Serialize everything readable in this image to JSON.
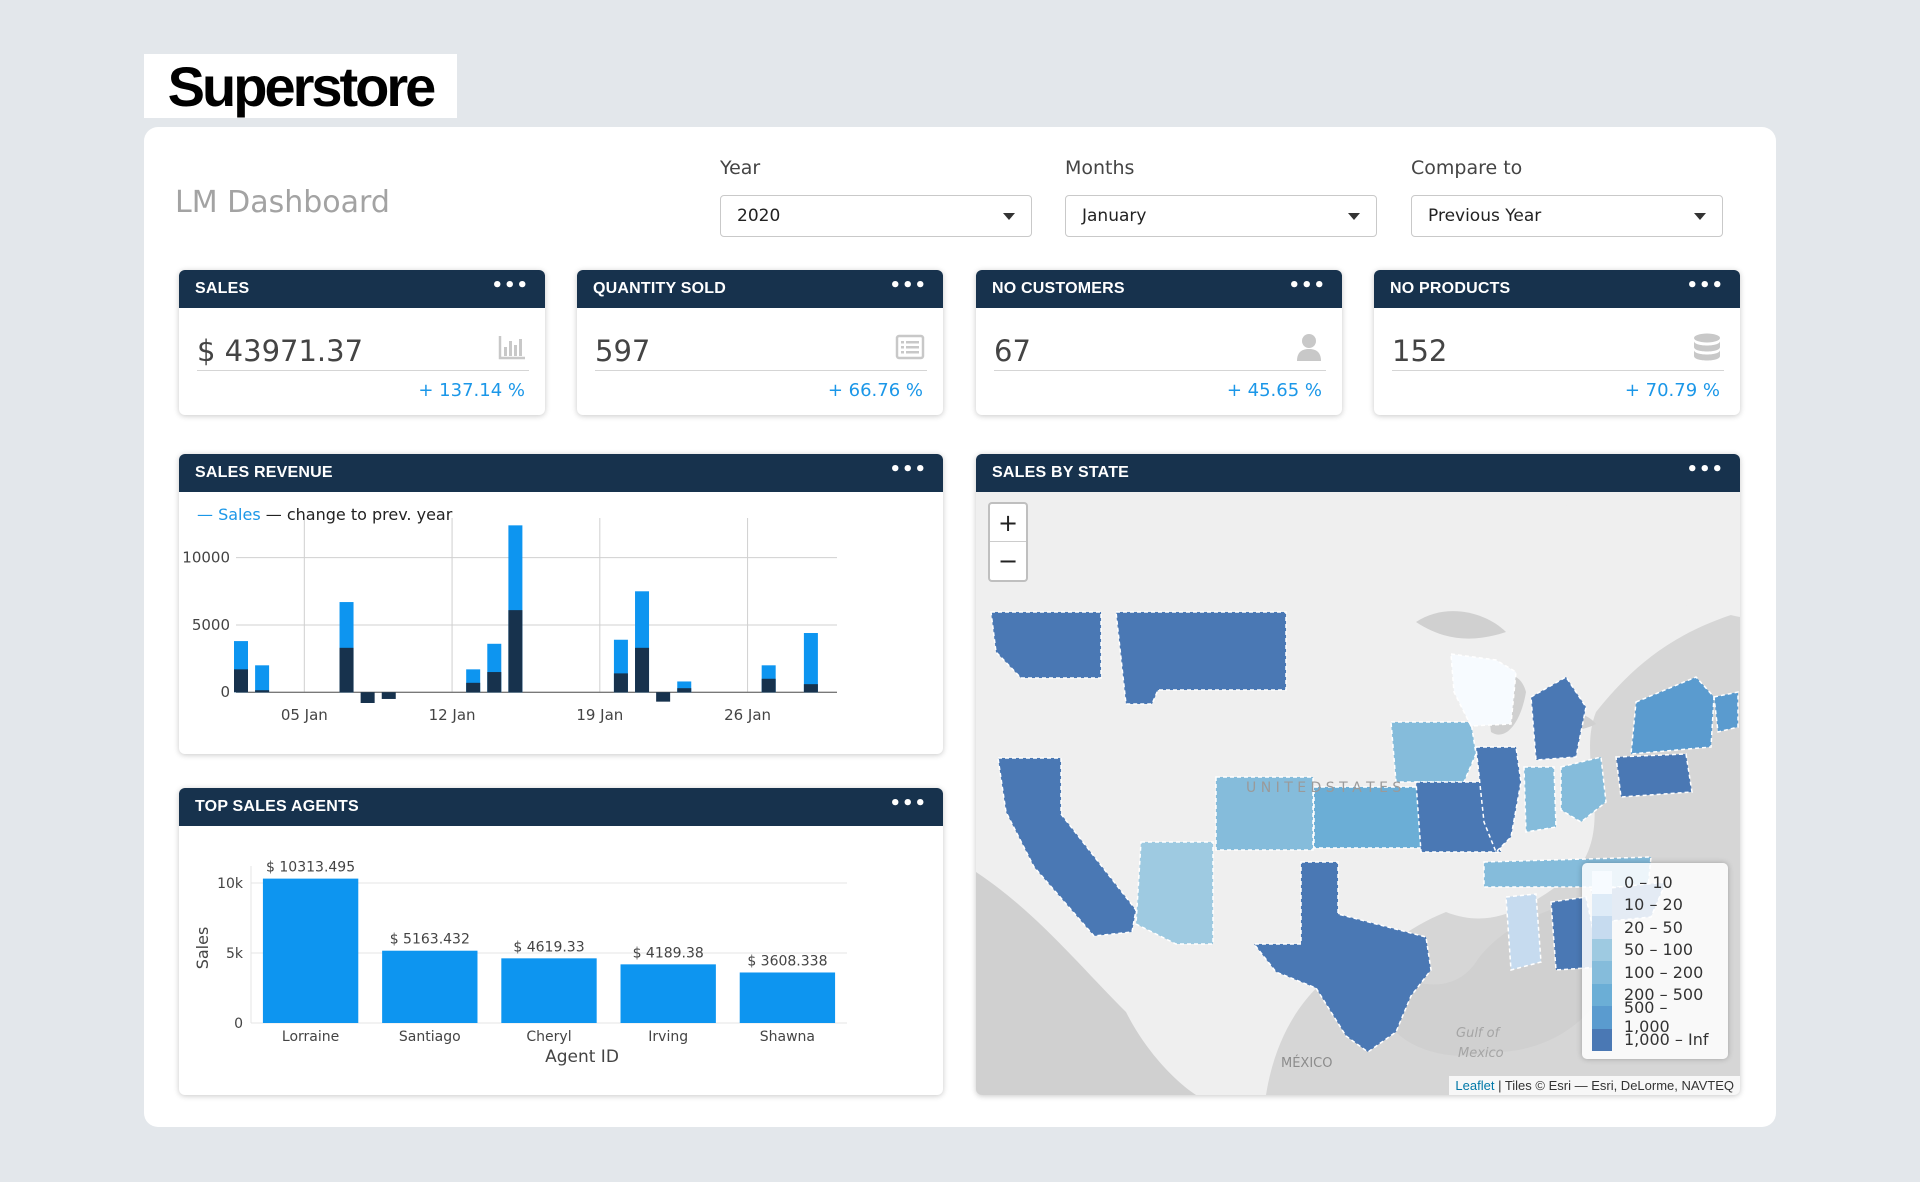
{
  "brand": {
    "logo_text": "Superstore"
  },
  "header": {
    "title": "LM Dashboard"
  },
  "filters": {
    "year": {
      "label": "Year",
      "value": "2020"
    },
    "months": {
      "label": "Months",
      "value": "January"
    },
    "compare": {
      "label": "Compare to",
      "value": "Previous Year"
    }
  },
  "kpis": [
    {
      "title": "SALES",
      "value": "$ 43971.37",
      "change": "+ 137.14 %",
      "icon": "bar-chart-icon"
    },
    {
      "title": "QUANTITY SOLD",
      "value": "597",
      "change": "+ 66.76 %",
      "icon": "list-icon"
    },
    {
      "title": "NO CUSTOMERS",
      "value": "67",
      "change": "+ 45.65 %",
      "icon": "user-icon"
    },
    {
      "title": "NO PRODUCTS",
      "value": "152",
      "change": "+ 70.79 %",
      "icon": "database-icon"
    }
  ],
  "menu_dots": "•••",
  "colors": {
    "header": "#17324d",
    "accent": "#1b97e8",
    "bar_primary": "#0d95f0",
    "bar_dark": "#17324d"
  },
  "revenue_card": {
    "title": "SALES REVENUE"
  },
  "agents_card": {
    "title": "TOP SALES AGENTS"
  },
  "map_card": {
    "title": "SALES BY STATE",
    "zoom_in": "+",
    "zoom_out": "−",
    "labels": {
      "country": "U N I T E D   S T A T E S",
      "mexico": "MÉXICO",
      "gulf_line1": "Gulf of",
      "gulf_line2": "Mexico"
    },
    "attribution": {
      "link": "Leaflet",
      "text": " | Tiles © Esri — Esri, DeLorme, NAVTEQ"
    },
    "legend": [
      {
        "label": "0 – 10",
        "color": "#f7fbff"
      },
      {
        "label": "10 – 20",
        "color": "#deebf7"
      },
      {
        "label": "20 – 50",
        "color": "#c6dbef"
      },
      {
        "label": "50 – 100",
        "color": "#9ecae1"
      },
      {
        "label": "100 – 200",
        "color": "#85bcdb"
      },
      {
        "label": "200 – 500",
        "color": "#6baed6"
      },
      {
        "label": "500 – 1,000",
        "color": "#5a9bcf"
      },
      {
        "label": "1,000 – Inf",
        "color": "#4a78b4"
      }
    ]
  },
  "chart_data": [
    {
      "type": "bar",
      "legend": {
        "sales": "Sales",
        "change": "change to prev. year"
      },
      "x_ticks": [
        {
          "label": "05 Jan",
          "day": 5
        },
        {
          "label": "12 Jan",
          "day": 12
        },
        {
          "label": "19 Jan",
          "day": 19
        },
        {
          "label": "26 Jan",
          "day": 26
        }
      ],
      "y_ticks": [
        0,
        5000,
        10000
      ],
      "ylim": [
        -800,
        12500
      ],
      "xlim": [
        2,
        30
      ],
      "series": [
        {
          "name": "Sales",
          "color": "#0d95f0",
          "points": [
            {
              "day": 2,
              "value": 3800
            },
            {
              "day": 3,
              "value": 2000
            },
            {
              "day": 7,
              "value": 6700
            },
            {
              "day": 13,
              "value": 1700
            },
            {
              "day": 14,
              "value": 3600
            },
            {
              "day": 15,
              "value": 12400
            },
            {
              "day": 20,
              "value": 3900
            },
            {
              "day": 21,
              "value": 7500
            },
            {
              "day": 23,
              "value": 800
            },
            {
              "day": 27,
              "value": 2000
            },
            {
              "day": 29,
              "value": 4400
            }
          ]
        },
        {
          "name": "change to prev. year",
          "color": "#17324d",
          "points": [
            {
              "day": 2,
              "value": 1700
            },
            {
              "day": 3,
              "value": 150
            },
            {
              "day": 7,
              "value": 3300
            },
            {
              "day": 8,
              "value": -800
            },
            {
              "day": 9,
              "value": -500
            },
            {
              "day": 13,
              "value": 700
            },
            {
              "day": 14,
              "value": 1500
            },
            {
              "day": 15,
              "value": 6100
            },
            {
              "day": 20,
              "value": 1400
            },
            {
              "day": 21,
              "value": 3300
            },
            {
              "day": 22,
              "value": -700
            },
            {
              "day": 23,
              "value": 300
            },
            {
              "day": 27,
              "value": 1000
            },
            {
              "day": 29,
              "value": 600
            }
          ]
        }
      ]
    },
    {
      "type": "bar",
      "xlabel": "Agent ID",
      "ylabel": "Sales",
      "y_ticks": [
        {
          "label": "0",
          "value": 0
        },
        {
          "label": "5k",
          "value": 5000
        },
        {
          "label": "10k",
          "value": 10000
        }
      ],
      "ylim": [
        0,
        10500
      ],
      "categories": [
        "Lorraine",
        "Santiago",
        "Cheryl",
        "Irving",
        "Shawna"
      ],
      "values": [
        10313.495,
        5163.432,
        4619.33,
        4189.38,
        3608.338
      ],
      "value_labels": [
        "$ 10313.495",
        "$ 5163.432",
        "$ 4619.33",
        "$ 4189.38",
        "$ 3608.338"
      ]
    }
  ]
}
